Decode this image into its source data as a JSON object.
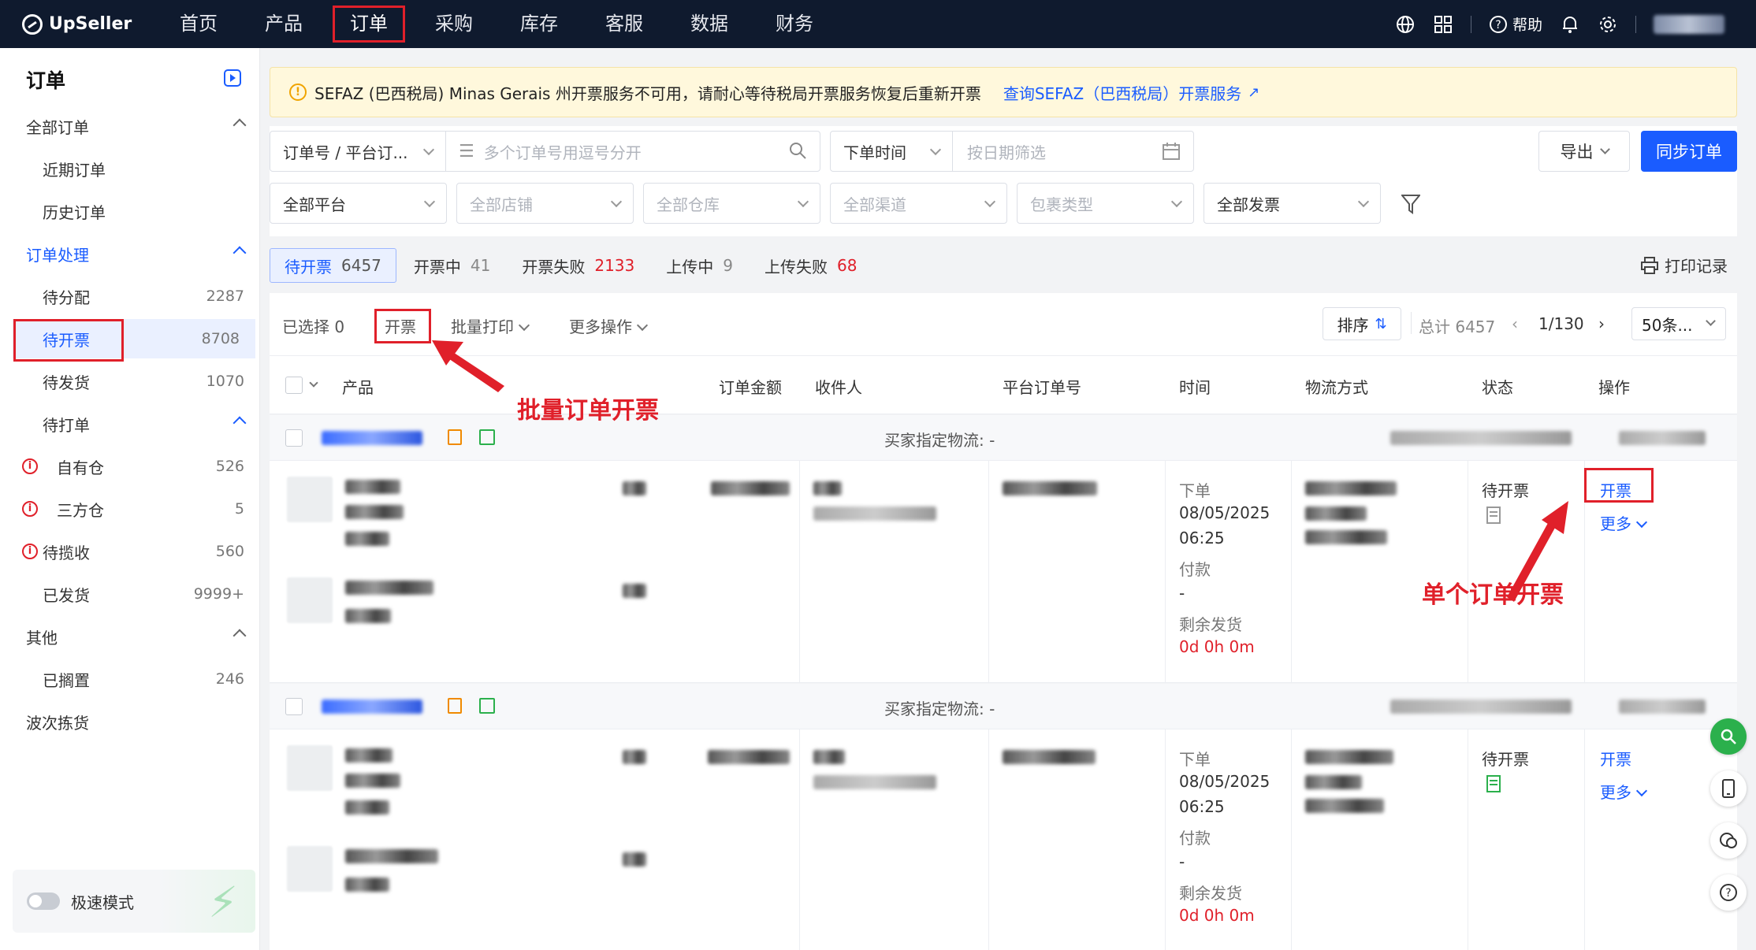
{
  "topnav": {
    "brand": "UpSeller",
    "items": [
      "首页",
      "产品",
      "订单",
      "采购",
      "库存",
      "客服",
      "数据",
      "财务"
    ],
    "active": "订单",
    "help_label": "帮助"
  },
  "sidebar": {
    "title": "订单",
    "groups": {
      "all_orders": "全部订单",
      "recent": "近期订单",
      "history": "历史订单",
      "processing": "订单处理",
      "to_assign": {
        "label": "待分配",
        "count": "2287"
      },
      "to_invoice": {
        "label": "待开票",
        "count": "8708"
      },
      "to_ship": {
        "label": "待发货",
        "count": "1070"
      },
      "to_print": "待打单",
      "own_wh": {
        "label": "自有仓",
        "count": "526"
      },
      "third_wh": {
        "label": "三方仓",
        "count": "5"
      },
      "to_pickup": {
        "label": "待揽收",
        "count": "560"
      },
      "shipped": {
        "label": "已发货",
        "count": "9999+"
      },
      "other": "其他",
      "shelved": {
        "label": "已搁置",
        "count": "246"
      },
      "wave": "波次拣货"
    },
    "speed_mode": "极速模式"
  },
  "banner": {
    "message": "SEFAZ (巴西税局) Minas Gerais 州开票服务不可用，请耐心等待税局开票服务恢复后重新开票",
    "link": "查询SEFAZ（巴西税局）开票服务"
  },
  "filters": {
    "order_type": "订单号 / 平台订...",
    "order_search_placeholder": "多个订单号用逗号分开",
    "time_type": "下单时间",
    "date_placeholder": "按日期筛选",
    "export": "导出",
    "sync": "同步订单",
    "platform": "全部平台",
    "store": "全部店铺",
    "warehouse": "全部仓库",
    "channel": "全部渠道",
    "package": "包裹类型",
    "invoice": "全部发票"
  },
  "tabs": [
    {
      "label": "待开票",
      "count": "6457"
    },
    {
      "label": "开票中",
      "count": "41"
    },
    {
      "label": "开票失败",
      "count": "2133"
    },
    {
      "label": "上传中",
      "count": "9"
    },
    {
      "label": "上传失败",
      "count": "68"
    }
  ],
  "print_record": "打印记录",
  "toolbar": {
    "selected": "已选择 0",
    "invoice": "开票",
    "batch_print": "批量打印",
    "more_ops": "更多操作",
    "sort": "排序",
    "total": "总计 6457",
    "page": "1/130",
    "page_size": "50条..."
  },
  "columns": [
    "产品",
    "订单金额",
    "收件人",
    "平台订单号",
    "时间",
    "物流方式",
    "状态",
    "操作"
  ],
  "orders": [
    {
      "buyer_logistics": "买家指定物流: -",
      "time_order_label": "下单",
      "date": "08/05/2025",
      "clock": "06:25",
      "pay_label": "付款",
      "pay_value": "-",
      "remain_label": "剩余发货",
      "remain_value": "0d 0h 0m",
      "status": "待开票",
      "action": "开票",
      "more": "更多"
    },
    {
      "buyer_logistics": "买家指定物流: -",
      "time_order_label": "下单",
      "date": "08/05/2025",
      "clock": "06:25",
      "pay_label": "付款",
      "pay_value": "-",
      "remain_label": "剩余发货",
      "remain_value": "0d 0h 0m",
      "status": "待开票",
      "action": "开票",
      "more": "更多"
    }
  ],
  "annotations": {
    "batch": "批量订单开票",
    "single": "单个订单开票"
  },
  "colors": {
    "accent": "#1a5cff",
    "highlight": "#e0202a",
    "nav_bg": "#0f1a2e"
  }
}
